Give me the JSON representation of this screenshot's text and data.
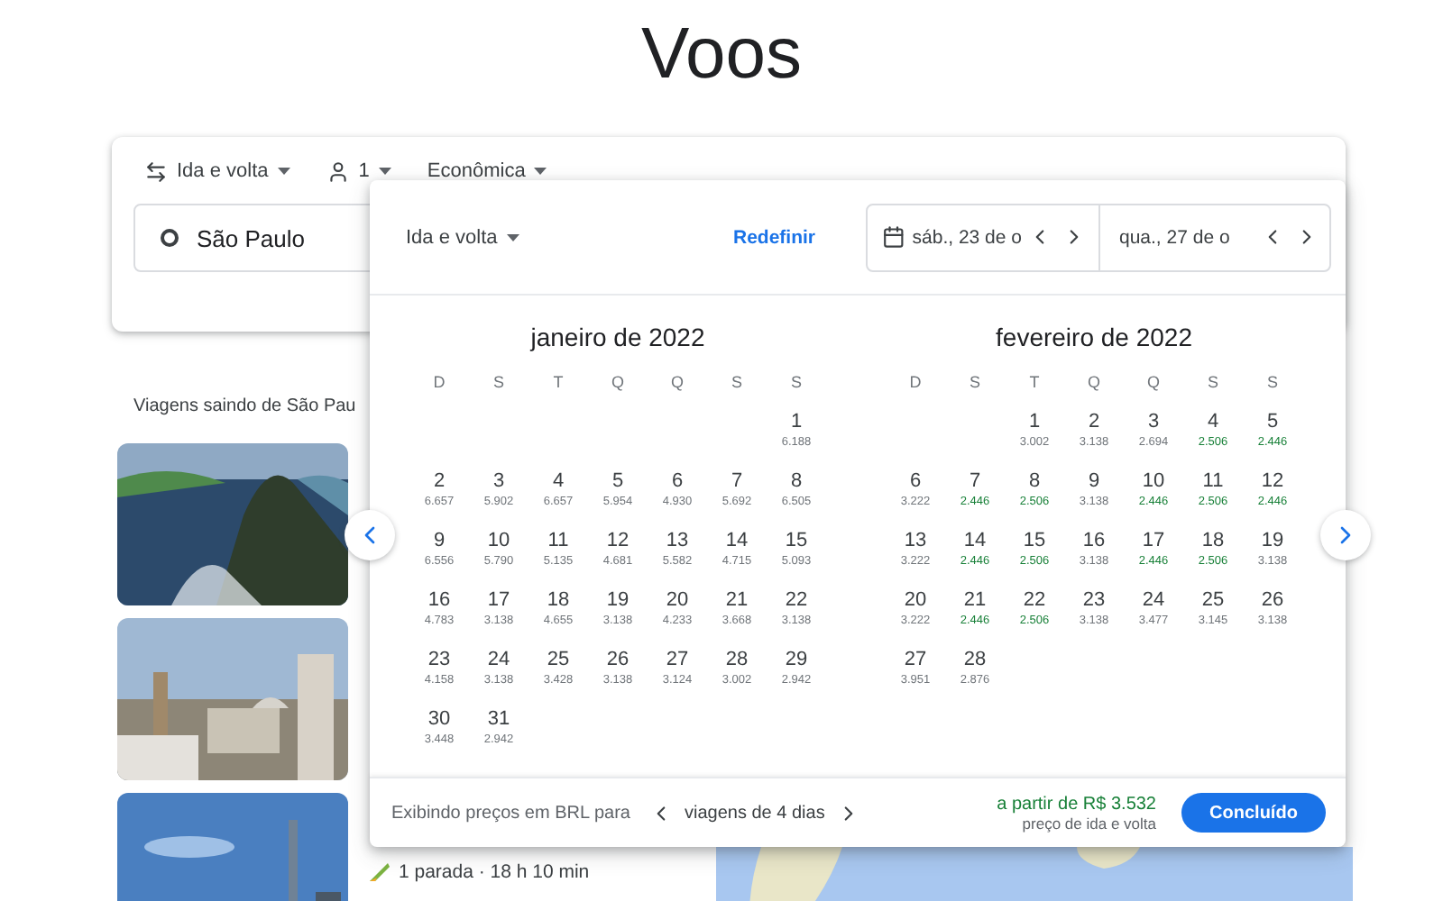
{
  "page_title": "Voos",
  "search": {
    "trip_type": "Ida e volta",
    "passengers": "1",
    "cabin": "Econômica",
    "origin": "São Paulo"
  },
  "section_title": "Viagens saindo de São Pau",
  "destinations": [
    {
      "kind": "picture"
    },
    {
      "kind": "picture"
    },
    {
      "kind": "picture",
      "details": "1 parada · 18 h 10 min"
    }
  ],
  "map": {
    "kind": "picture"
  },
  "calendar": {
    "trip_type": "Ida e volta",
    "reset": "Redefinir",
    "departure": "sáb., 23 de o",
    "return": "qua., 27 de o",
    "months": [
      {
        "title": "janeiro de 2022",
        "weekdays": [
          "D",
          "S",
          "T",
          "Q",
          "Q",
          "S",
          "S"
        ],
        "days": [
          {
            "kind": "blank"
          },
          {
            "kind": "blank"
          },
          {
            "kind": "blank"
          },
          {
            "kind": "blank"
          },
          {
            "kind": "blank"
          },
          {
            "kind": "blank"
          },
          {
            "kind": "day",
            "day": "1",
            "price": "6.188",
            "cheap": false
          },
          {
            "kind": "day",
            "day": "2",
            "price": "6.657",
            "cheap": false
          },
          {
            "kind": "day",
            "day": "3",
            "price": "5.902",
            "cheap": false
          },
          {
            "kind": "day",
            "day": "4",
            "price": "6.657",
            "cheap": false
          },
          {
            "kind": "day",
            "day": "5",
            "price": "5.954",
            "cheap": false
          },
          {
            "kind": "day",
            "day": "6",
            "price": "4.930",
            "cheap": false
          },
          {
            "kind": "day",
            "day": "7",
            "price": "5.692",
            "cheap": false
          },
          {
            "kind": "day",
            "day": "8",
            "price": "6.505",
            "cheap": false
          },
          {
            "kind": "day",
            "day": "9",
            "price": "6.556",
            "cheap": false
          },
          {
            "kind": "day",
            "day": "10",
            "price": "5.790",
            "cheap": false
          },
          {
            "kind": "day",
            "day": "11",
            "price": "5.135",
            "cheap": false
          },
          {
            "kind": "day",
            "day": "12",
            "price": "4.681",
            "cheap": false
          },
          {
            "kind": "day",
            "day": "13",
            "price": "5.582",
            "cheap": false
          },
          {
            "kind": "day",
            "day": "14",
            "price": "4.715",
            "cheap": false
          },
          {
            "kind": "day",
            "day": "15",
            "price": "5.093",
            "cheap": false
          },
          {
            "kind": "day",
            "day": "16",
            "price": "4.783",
            "cheap": false
          },
          {
            "kind": "day",
            "day": "17",
            "price": "3.138",
            "cheap": false
          },
          {
            "kind": "day",
            "day": "18",
            "price": "4.655",
            "cheap": false
          },
          {
            "kind": "day",
            "day": "19",
            "price": "3.138",
            "cheap": false
          },
          {
            "kind": "day",
            "day": "20",
            "price": "4.233",
            "cheap": false
          },
          {
            "kind": "day",
            "day": "21",
            "price": "3.668",
            "cheap": false
          },
          {
            "kind": "day",
            "day": "22",
            "price": "3.138",
            "cheap": false
          },
          {
            "kind": "day",
            "day": "23",
            "price": "4.158",
            "cheap": false
          },
          {
            "kind": "day",
            "day": "24",
            "price": "3.138",
            "cheap": false
          },
          {
            "kind": "day",
            "day": "25",
            "price": "3.428",
            "cheap": false
          },
          {
            "kind": "day",
            "day": "26",
            "price": "3.138",
            "cheap": false
          },
          {
            "kind": "day",
            "day": "27",
            "price": "3.124",
            "cheap": false
          },
          {
            "kind": "day",
            "day": "28",
            "price": "3.002",
            "cheap": false
          },
          {
            "kind": "day",
            "day": "29",
            "price": "2.942",
            "cheap": false
          },
          {
            "kind": "day",
            "day": "30",
            "price": "3.448",
            "cheap": false
          },
          {
            "kind": "day",
            "day": "31",
            "price": "2.942",
            "cheap": false
          }
        ]
      },
      {
        "title": "fevereiro de 2022",
        "weekdays": [
          "D",
          "S",
          "T",
          "Q",
          "Q",
          "S",
          "S"
        ],
        "days": [
          {
            "kind": "blank"
          },
          {
            "kind": "blank"
          },
          {
            "kind": "day",
            "day": "1",
            "price": "3.002",
            "cheap": false
          },
          {
            "kind": "day",
            "day": "2",
            "price": "3.138",
            "cheap": false
          },
          {
            "kind": "day",
            "day": "3",
            "price": "2.694",
            "cheap": false
          },
          {
            "kind": "day",
            "day": "4",
            "price": "2.506",
            "cheap": true
          },
          {
            "kind": "day",
            "day": "5",
            "price": "2.446",
            "cheap": true
          },
          {
            "kind": "day",
            "day": "6",
            "price": "3.222",
            "cheap": false
          },
          {
            "kind": "day",
            "day": "7",
            "price": "2.446",
            "cheap": true
          },
          {
            "kind": "day",
            "day": "8",
            "price": "2.506",
            "cheap": true
          },
          {
            "kind": "day",
            "day": "9",
            "price": "3.138",
            "cheap": false
          },
          {
            "kind": "day",
            "day": "10",
            "price": "2.446",
            "cheap": true
          },
          {
            "kind": "day",
            "day": "11",
            "price": "2.506",
            "cheap": true
          },
          {
            "kind": "day",
            "day": "12",
            "price": "2.446",
            "cheap": true
          },
          {
            "kind": "day",
            "day": "13",
            "price": "3.222",
            "cheap": false
          },
          {
            "kind": "day",
            "day": "14",
            "price": "2.446",
            "cheap": true
          },
          {
            "kind": "day",
            "day": "15",
            "price": "2.506",
            "cheap": true
          },
          {
            "kind": "day",
            "day": "16",
            "price": "3.138",
            "cheap": false
          },
          {
            "kind": "day",
            "day": "17",
            "price": "2.446",
            "cheap": true
          },
          {
            "kind": "day",
            "day": "18",
            "price": "2.506",
            "cheap": true
          },
          {
            "kind": "day",
            "day": "19",
            "price": "3.138",
            "cheap": false
          },
          {
            "kind": "day",
            "day": "20",
            "price": "3.222",
            "cheap": false
          },
          {
            "kind": "day",
            "day": "21",
            "price": "2.446",
            "cheap": true
          },
          {
            "kind": "day",
            "day": "22",
            "price": "2.506",
            "cheap": true
          },
          {
            "kind": "day",
            "day": "23",
            "price": "3.138",
            "cheap": false
          },
          {
            "kind": "day",
            "day": "24",
            "price": "3.477",
            "cheap": false
          },
          {
            "kind": "day",
            "day": "25",
            "price": "3.145",
            "cheap": false
          },
          {
            "kind": "day",
            "day": "26",
            "price": "3.138",
            "cheap": false
          },
          {
            "kind": "day",
            "day": "27",
            "price": "3.951",
            "cheap": false
          },
          {
            "kind": "day",
            "day": "28",
            "price": "2.876",
            "cheap": false
          }
        ]
      }
    ],
    "footer": {
      "note": "Exibindo preços em BRL para",
      "duration": "viagens de 4 dias",
      "price": "a partir de R$ 3.532",
      "price_note": "preço de ida e volta",
      "done": "Concluído"
    }
  }
}
